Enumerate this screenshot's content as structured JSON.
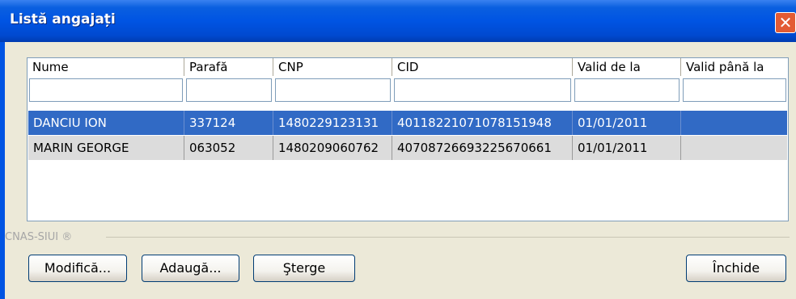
{
  "window": {
    "title": "Listă angajați",
    "close_symbol": "✕"
  },
  "grid": {
    "columns": [
      "Nume",
      "Parafă",
      "CNP",
      "CID",
      "Valid de la",
      "Valid până la"
    ],
    "rows": [
      {
        "selected": true,
        "cells": [
          "DANCIU ION",
          "337124",
          "1480229123131",
          "40118221071078151948",
          "01/01/2011",
          ""
        ]
      },
      {
        "selected": false,
        "cells": [
          "MARIN GEORGE",
          "063052",
          "1480209060762",
          "40708726693225670661",
          "01/01/2011",
          ""
        ]
      }
    ]
  },
  "footer": {
    "brand": "CNAS-SIUI ®"
  },
  "buttons": {
    "modify": "Modifică...",
    "add": "Adaugă...",
    "delete": "Şterge",
    "close": "Închide"
  },
  "colors": {
    "title_bar": "#0054e3",
    "selection": "#316ac5",
    "row_normal": "#dcdcdc"
  }
}
